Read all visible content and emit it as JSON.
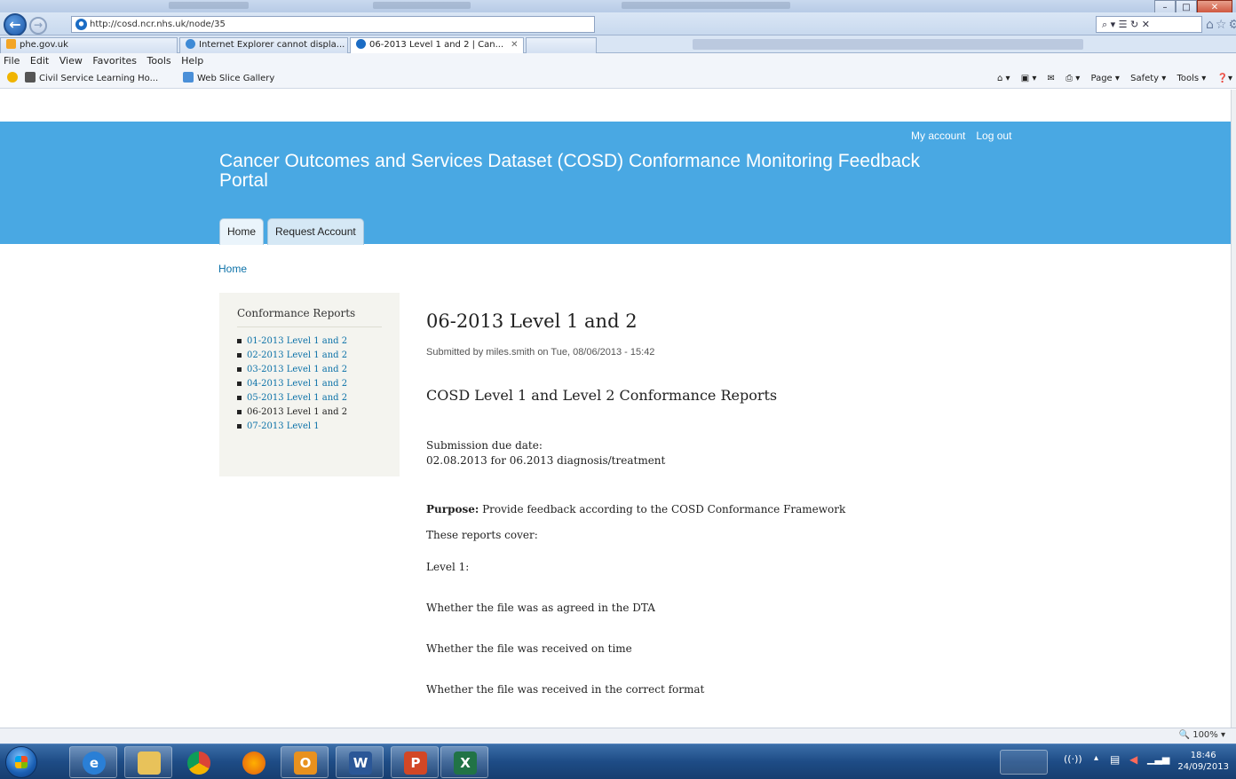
{
  "browser": {
    "address_url": "http://cosd.ncr.nhs.uk/node/35",
    "address_tools": "⌕ ▾ ☰ ↻ ✕",
    "tabs": [
      {
        "label": "phe.gov.uk"
      },
      {
        "label": "Internet Explorer cannot displa..."
      },
      {
        "label": "06-2013 Level 1 and 2 | Can..."
      }
    ],
    "tab_close": "✕",
    "menu": [
      "File",
      "Edit",
      "View",
      "Favorites",
      "Tools",
      "Help"
    ],
    "favorites": [
      {
        "label": "Civil Service Learning Ho..."
      },
      {
        "label": "Web Slice Gallery"
      }
    ],
    "command_bar": [
      "Page ▾",
      "Safety ▾",
      "Tools ▾"
    ],
    "zoom": "100%"
  },
  "site": {
    "user_links": [
      "My account",
      "Log out"
    ],
    "name": "Cancer Outcomes and Services Dataset (COSD) Conformance Monitoring Feedback Portal",
    "primary_tabs": [
      "Home",
      "Request Account"
    ],
    "breadcrumb": "Home"
  },
  "sidebar": {
    "title": "Conformance Reports",
    "items": [
      {
        "label": "01-2013 Level 1 and 2"
      },
      {
        "label": "02-2013 Level 1 and 2"
      },
      {
        "label": "03-2013 Level 1 and 2"
      },
      {
        "label": "04-2013 Level 1 and 2"
      },
      {
        "label": "05-2013 Level 1 and 2"
      },
      {
        "label": "06-2013 Level 1 and 2"
      },
      {
        "label": "07-2013 Level 1"
      }
    ]
  },
  "content": {
    "title": "06-2013 Level 1 and 2",
    "submitted": "Submitted by miles.smith on Tue, 08/06/2013 - 15:42",
    "subtitle": "COSD Level 1 and Level 2 Conformance Reports",
    "due_label": "Submission due date:",
    "due_value": "02.08.2013 for 06.2013 diagnosis/treatment",
    "purpose_label": "Purpose:",
    "purpose_text": " Provide feedback according to the COSD Conformance Framework",
    "covers": "These reports cover:",
    "level1": "Level 1:",
    "criteria": [
      "Whether the file was as agreed in the DTA",
      "Whether the file was received on time",
      "Whether the file was received in the correct format"
    ]
  },
  "taskbar": {
    "clock_time": "18:46",
    "clock_date": "24/09/2013"
  },
  "colors": {
    "header_bg": "#49a8e3",
    "link": "#0b71a8",
    "sidebar_bg": "#f4f4ef"
  }
}
